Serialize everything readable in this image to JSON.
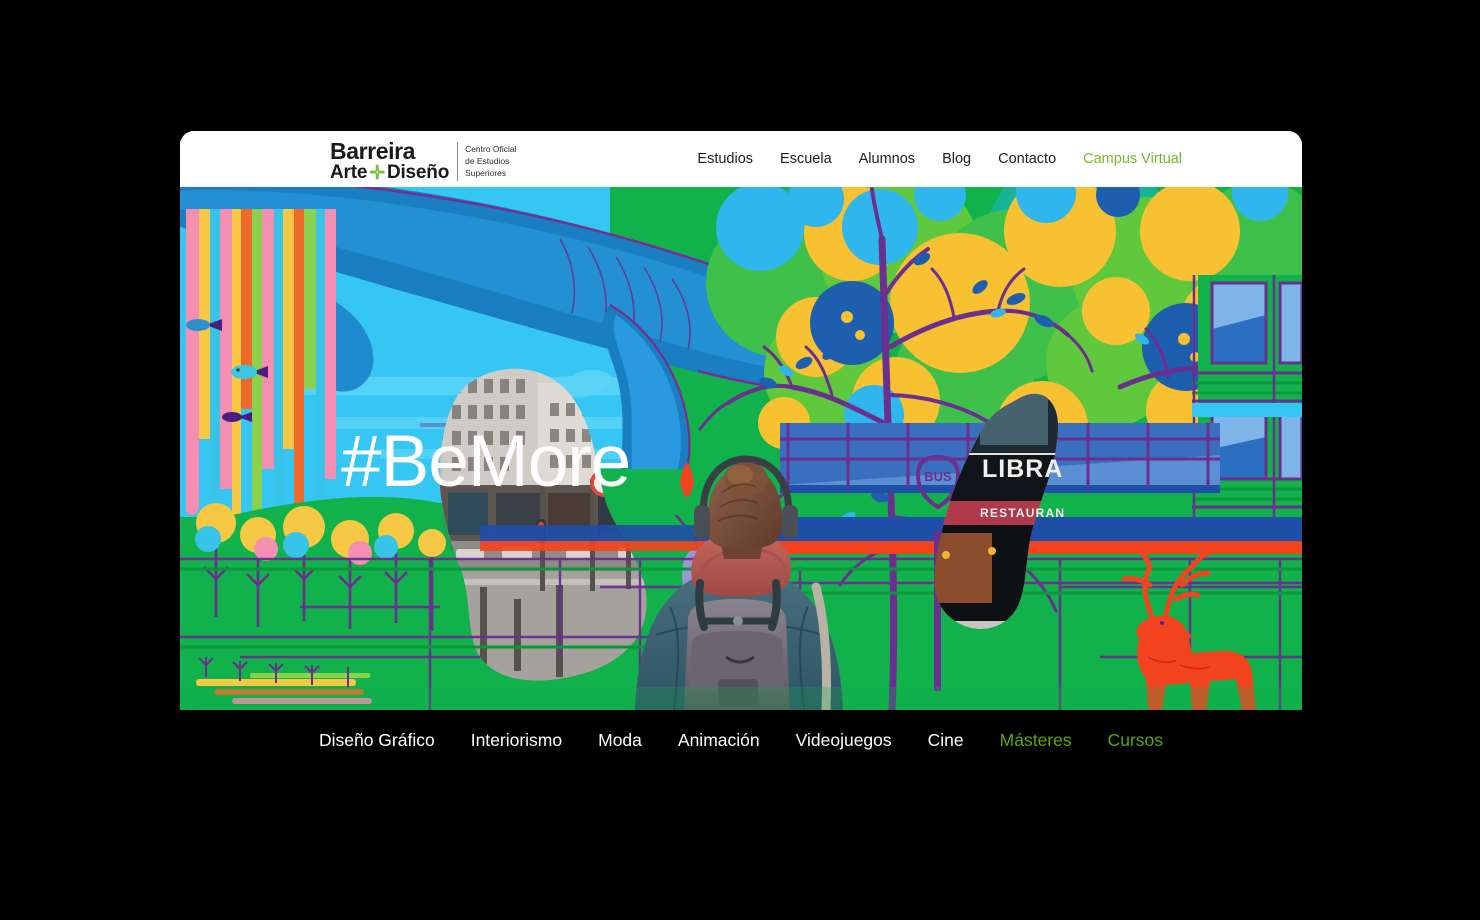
{
  "window": {
    "title": "Barreira Arte + Diseño"
  },
  "header": {
    "logo": {
      "word1": "Barreira",
      "word2_a": "Arte",
      "plus": "✛",
      "word2_b": "Diseño",
      "tag_line1": "Centro Oficial",
      "tag_line2": "de Estudios",
      "tag_line3": "Superiores"
    },
    "nav": [
      {
        "label": "Estudios",
        "accent": false
      },
      {
        "label": "Escuela",
        "accent": false
      },
      {
        "label": "Alumnos",
        "accent": false
      },
      {
        "label": "Blog",
        "accent": false
      },
      {
        "label": "Contacto",
        "accent": false
      },
      {
        "label": "Campus Virtual",
        "accent": true
      }
    ]
  },
  "hero": {
    "headline": "#BeMore",
    "mural_signs": {
      "library": "LIBRA",
      "restaurant": "RESTAURAN",
      "bus_stop": "BUS"
    },
    "alt": "Mural ilustrado con ballena, árboles y ciervo; estudiante de espaldas con mochila"
  },
  "bottom_nav": [
    {
      "label": "Diseño Gráfico",
      "accent": false
    },
    {
      "label": "Interiorismo",
      "accent": false
    },
    {
      "label": "Moda",
      "accent": false
    },
    {
      "label": "Animación",
      "accent": false
    },
    {
      "label": "Videojuegos",
      "accent": false
    },
    {
      "label": "Cine",
      "accent": false
    },
    {
      "label": "Másteres",
      "accent": true
    },
    {
      "label": "Cursos",
      "accent": true
    }
  ],
  "colors": {
    "page_background": "#000000",
    "header_background": "#ffffff",
    "accent_green": "#76b82a",
    "bottom_accent_green": "#5aa800",
    "mural_green": "#11b14c",
    "mural_sky": "#35c6f4",
    "mural_purple": "#5b1e8c",
    "mural_yellow": "#f6c326",
    "mural_red": "#f4431f"
  }
}
